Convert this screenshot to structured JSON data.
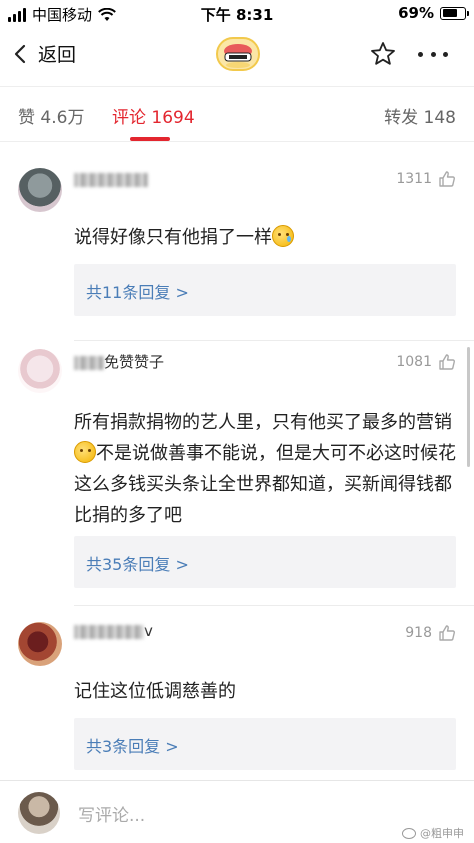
{
  "status_bar": {
    "carrier": "中国移动",
    "time": "下午 8:31",
    "battery": "69%",
    "battery_level": 0.69
  },
  "nav": {
    "back_label": "返回"
  },
  "tabs": {
    "likes": "赞 4.6万",
    "comments": "评论 1694",
    "reposts": "转发 148"
  },
  "comments": [
    {
      "name_visible": "",
      "likes": "1311",
      "text": "说得好像只有他捐了一样",
      "emoji": "tear-face",
      "replies": "共11条回复 >"
    },
    {
      "name_visible": "免赞赞子",
      "likes": "1081",
      "text": "所有捐款捐物的艺人里，只有他买了最多的营销",
      "text_after_emoji": "不是说做善事不能说，但是大可不必这时候花这么多钱买头条让全世界都知道，买新闻得钱都比捐的多了吧",
      "emoji": "thinking-face",
      "replies": "共35条回复 >"
    },
    {
      "name_visible": "v",
      "likes": "918",
      "text": "记住这位低调慈善的",
      "replies": "共3条回复 >"
    }
  ],
  "bottom": {
    "placeholder": "写评论...",
    "watermark": "@粗申申"
  },
  "colors": {
    "accent": "#e3262f",
    "link": "#4a7db7",
    "reply_bg": "#f3f3f5"
  }
}
